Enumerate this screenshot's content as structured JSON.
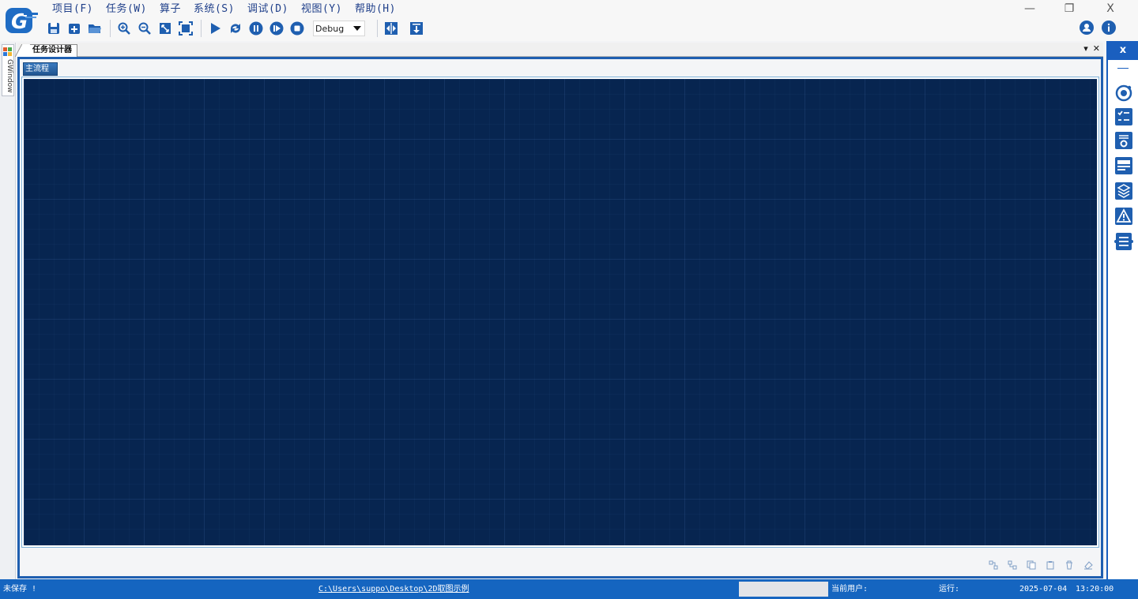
{
  "app": {
    "menu": [
      "项目(F)",
      "任务(W)",
      "算子",
      "系统(S)",
      "调试(D)",
      "视图(Y)",
      "帮助(H)"
    ],
    "window_controls": {
      "minimize": "—",
      "restore": "❐",
      "close": "X"
    }
  },
  "toolbar": {
    "mode_value": "Debug",
    "buttons": [
      "save-icon",
      "new-icon",
      "open-folder-icon",
      "zoom-in-icon",
      "zoom-out-icon",
      "fit-icon",
      "fullscreen-icon",
      "run-icon",
      "loop-icon",
      "pause-icon",
      "step-icon",
      "stop-icon",
      "align-icon",
      "download-icon"
    ],
    "user_icons": [
      "user-icon",
      "info-icon"
    ]
  },
  "left_dock": {
    "tab_label": "GWindow"
  },
  "document": {
    "tab_label": "任务设计器",
    "dropdown_glyph": "▾",
    "close_glyph": "✕",
    "subtab_label": "主流程"
  },
  "right_dock": {
    "close_label": "x",
    "icons": [
      "camera-icon",
      "checklist-icon",
      "settings-list-icon",
      "panel-icon",
      "layers-icon",
      "warning-icon",
      "log-icon"
    ]
  },
  "status": {
    "save_state": "未保存 !",
    "project_path": "C:\\Users\\suppo\\Desktop\\2D取图示例",
    "current_user_label": "当前用户:",
    "run_label": "运行:",
    "date": "2025-07-04",
    "time": "13:20:00"
  },
  "colors": {
    "accent": "#1a5fbf",
    "canvas": "#072550",
    "status_bar": "#1565c0"
  }
}
